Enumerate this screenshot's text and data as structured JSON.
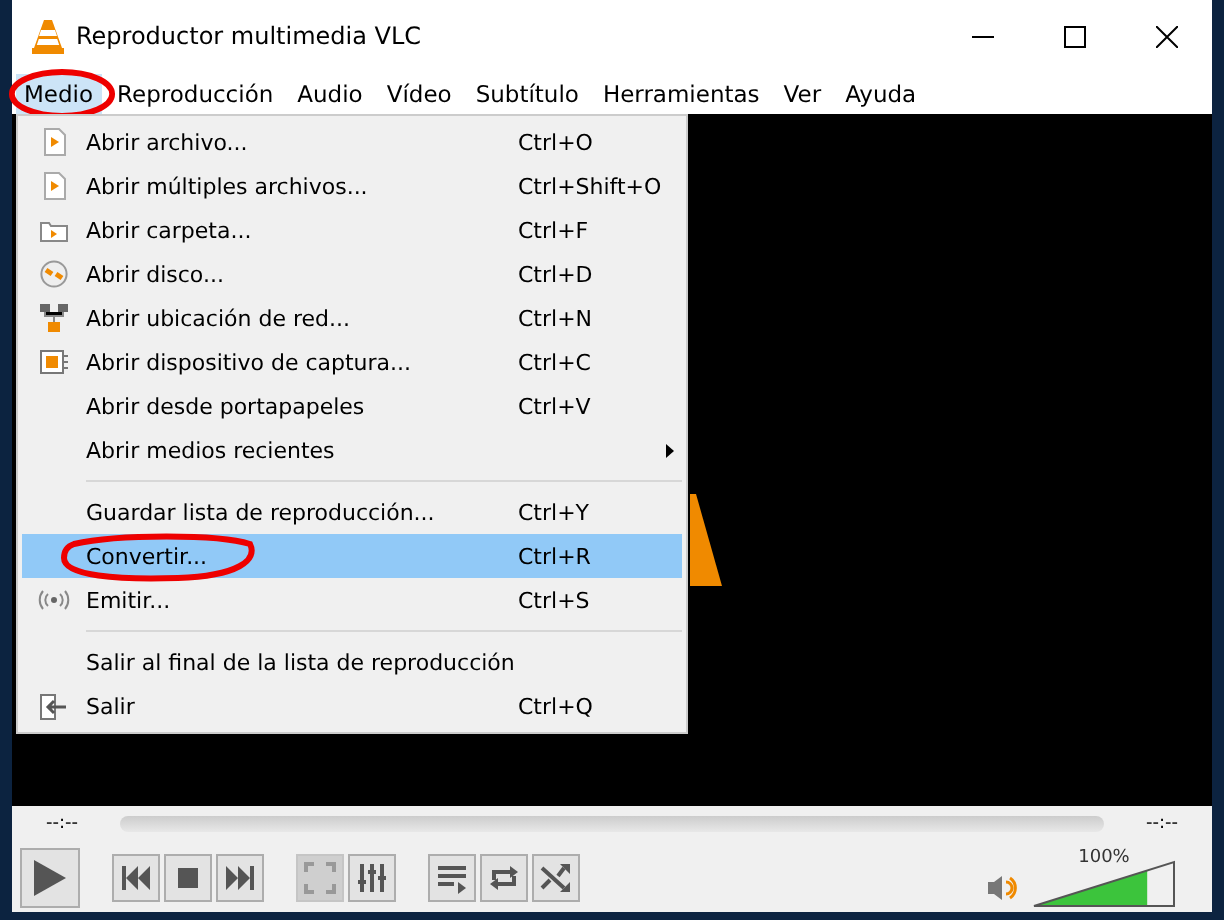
{
  "window": {
    "title": "Reproductor multimedia VLC"
  },
  "menubar": [
    {
      "label": "Medio",
      "selected": true
    },
    {
      "label": "Reproducción",
      "selected": false
    },
    {
      "label": "Audio",
      "selected": false
    },
    {
      "label": "Vídeo",
      "selected": false
    },
    {
      "label": "Subtítulo",
      "selected": false
    },
    {
      "label": "Herramientas",
      "selected": false
    },
    {
      "label": "Ver",
      "selected": false
    },
    {
      "label": "Ayuda",
      "selected": false
    }
  ],
  "menu": {
    "groups": [
      [
        {
          "label": "Abrir archivo...",
          "shortcut": "Ctrl+O",
          "selected": false
        },
        {
          "label": "Abrir múltiples archivos...",
          "shortcut": "Ctrl+Shift+O",
          "selected": false
        },
        {
          "label": "Abrir carpeta...",
          "shortcut": "Ctrl+F",
          "selected": false
        },
        {
          "label": "Abrir disco...",
          "shortcut": "Ctrl+D",
          "selected": false
        },
        {
          "label": "Abrir ubicación de red...",
          "shortcut": "Ctrl+N",
          "selected": false
        },
        {
          "label": "Abrir dispositivo de captura...",
          "shortcut": "Ctrl+C",
          "selected": false
        },
        {
          "label": "Abrir desde portapapeles",
          "shortcut": "Ctrl+V",
          "selected": false
        },
        {
          "label": "Abrir medios recientes",
          "submenu": true,
          "selected": false
        }
      ],
      [
        {
          "label": "Guardar lista de reproducción...",
          "shortcut": "Ctrl+Y",
          "selected": false
        },
        {
          "label": "Convertir...",
          "shortcut": "Ctrl+R",
          "selected": true
        },
        {
          "label": "Emitir...",
          "shortcut": "Ctrl+S",
          "selected": false
        }
      ],
      [
        {
          "label": "Salir al final de la lista de reproducción",
          "selected": false
        },
        {
          "label": "Salir",
          "shortcut": "Ctrl+Q",
          "selected": false
        }
      ]
    ]
  },
  "controls": {
    "elapsed": "--:--",
    "remaining": "--:--",
    "buttons": [
      {
        "kind": "prev",
        "disabled": false
      },
      {
        "kind": "stop",
        "disabled": false
      },
      {
        "kind": "next",
        "disabled": false
      },
      {
        "kind": "fullscreen",
        "disabled": true
      },
      {
        "kind": "equalizer",
        "disabled": false
      },
      {
        "kind": "playlist",
        "disabled": false
      },
      {
        "kind": "loop",
        "disabled": false
      },
      {
        "kind": "shuffle",
        "disabled": false
      }
    ],
    "volume": {
      "reading": "100%",
      "level": 0.8
    }
  }
}
